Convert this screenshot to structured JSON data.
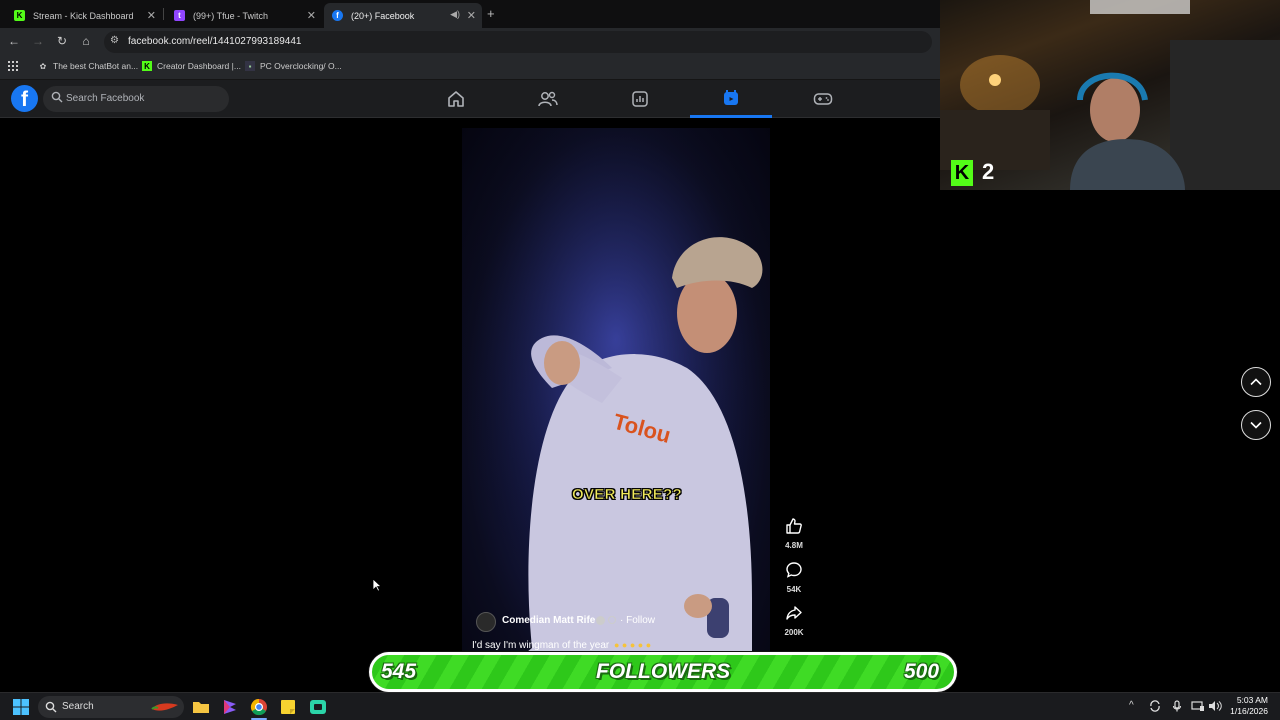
{
  "browser": {
    "tabs": [
      {
        "title": "Stream - Kick Dashboard",
        "favicon": "kick-icon",
        "active": false
      },
      {
        "title": "(99+) Tfue - Twitch",
        "favicon": "twitch-icon",
        "active": false
      },
      {
        "title": "(20+) Facebook",
        "favicon": "facebook-icon",
        "active": true
      }
    ],
    "url": "facebook.com/reel/1441027993189441",
    "bookmarks": [
      {
        "label": "The best ChatBot an...",
        "icon": "openai-icon"
      },
      {
        "label": "Creator Dashboard |...",
        "icon": "kick-icon"
      },
      {
        "label": "PC Overclocking/ O...",
        "icon": "site-icon"
      }
    ]
  },
  "facebook": {
    "search_placeholder": "Search Facebook",
    "nav": [
      "home-icon",
      "friends-icon",
      "dashboard-icon",
      "reels-icon",
      "gaming-icon"
    ],
    "active_nav": "reels-icon",
    "accent": "#1877f2"
  },
  "reel": {
    "caption": "OVER HERE??",
    "author": "Comedian Matt Rife",
    "follow_label": "Follow",
    "description": "I'd say I'm wingman of the year",
    "likes": "4.8M",
    "comments": "54K",
    "shares": "200K"
  },
  "overlay": {
    "kick_viewers": "2",
    "followers_current": "545",
    "followers_label": "FOLLOWERS",
    "followers_goal": "500",
    "kick_color": "#53fc18"
  },
  "taskbar": {
    "search_label": "Search",
    "time": "5:03 AM",
    "date": "1/16/2026"
  }
}
